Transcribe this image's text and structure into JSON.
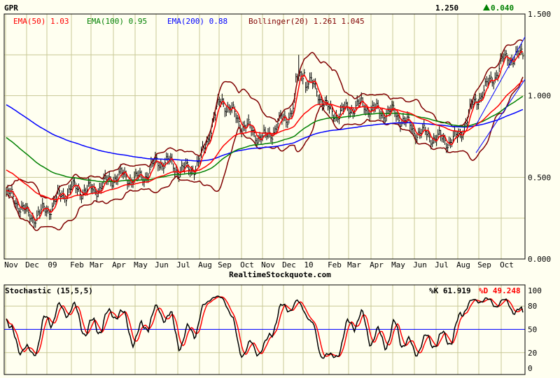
{
  "header": {
    "symbol": "GPR",
    "last": "1.250",
    "change": "0.040",
    "change_color": "#008000"
  },
  "legend": {
    "ema50": "EMA(50) 1.03",
    "ema100": "EMA(100) 0.95",
    "ema200": "EMA(200) 0.88",
    "boll": "Bollinger(20) 1.261 1.045"
  },
  "colors": {
    "ema50": "#ff0000",
    "ema100": "#008000",
    "ema200": "#0000ff",
    "boll": "#800000",
    "price": "#000000",
    "grid": "#c8c896"
  },
  "watermark": "RealtimeStockquote.com",
  "stoch": {
    "title": "Stochastic (15,5,5)",
    "k": "%K 61.919",
    "d": "%D 49.248",
    "yticks": [
      "100",
      "80",
      "50",
      "20",
      "0"
    ]
  },
  "chart_data": {
    "type": "line",
    "title": "GPR",
    "months": [
      "Nov",
      "Dec",
      "09",
      "Feb",
      "Mar",
      "Apr",
      "May",
      "Jun",
      "Jul",
      "Aug",
      "Sep",
      "Oct",
      "Nov",
      "Dec",
      "10",
      "Feb",
      "Mar",
      "Apr",
      "May",
      "Jun",
      "Jul",
      "Aug",
      "Sep",
      "Oct"
    ],
    "yticks": [
      "1.500",
      "1.000",
      "0.500",
      "0.000"
    ],
    "ylim": [
      0,
      1.5
    ],
    "approx_monthly_close": [
      0.4,
      0.27,
      0.3,
      0.45,
      0.4,
      0.52,
      0.47,
      0.6,
      0.55,
      0.58,
      1.0,
      0.8,
      0.75,
      0.85,
      1.1,
      0.9,
      0.92,
      0.93,
      0.88,
      0.8,
      0.72,
      0.75,
      1.0,
      1.2,
      1.25
    ],
    "series": [
      {
        "name": "Price"
      },
      {
        "name": "EMA(50)",
        "last": 1.03
      },
      {
        "name": "EMA(100)",
        "last": 0.95
      },
      {
        "name": "EMA(200)",
        "last": 0.88
      },
      {
        "name": "Bollinger(20)",
        "upper": 1.261,
        "lower": 1.045
      },
      {
        "name": "%K",
        "last": 61.919
      },
      {
        "name": "%D",
        "last": 49.248
      }
    ]
  }
}
